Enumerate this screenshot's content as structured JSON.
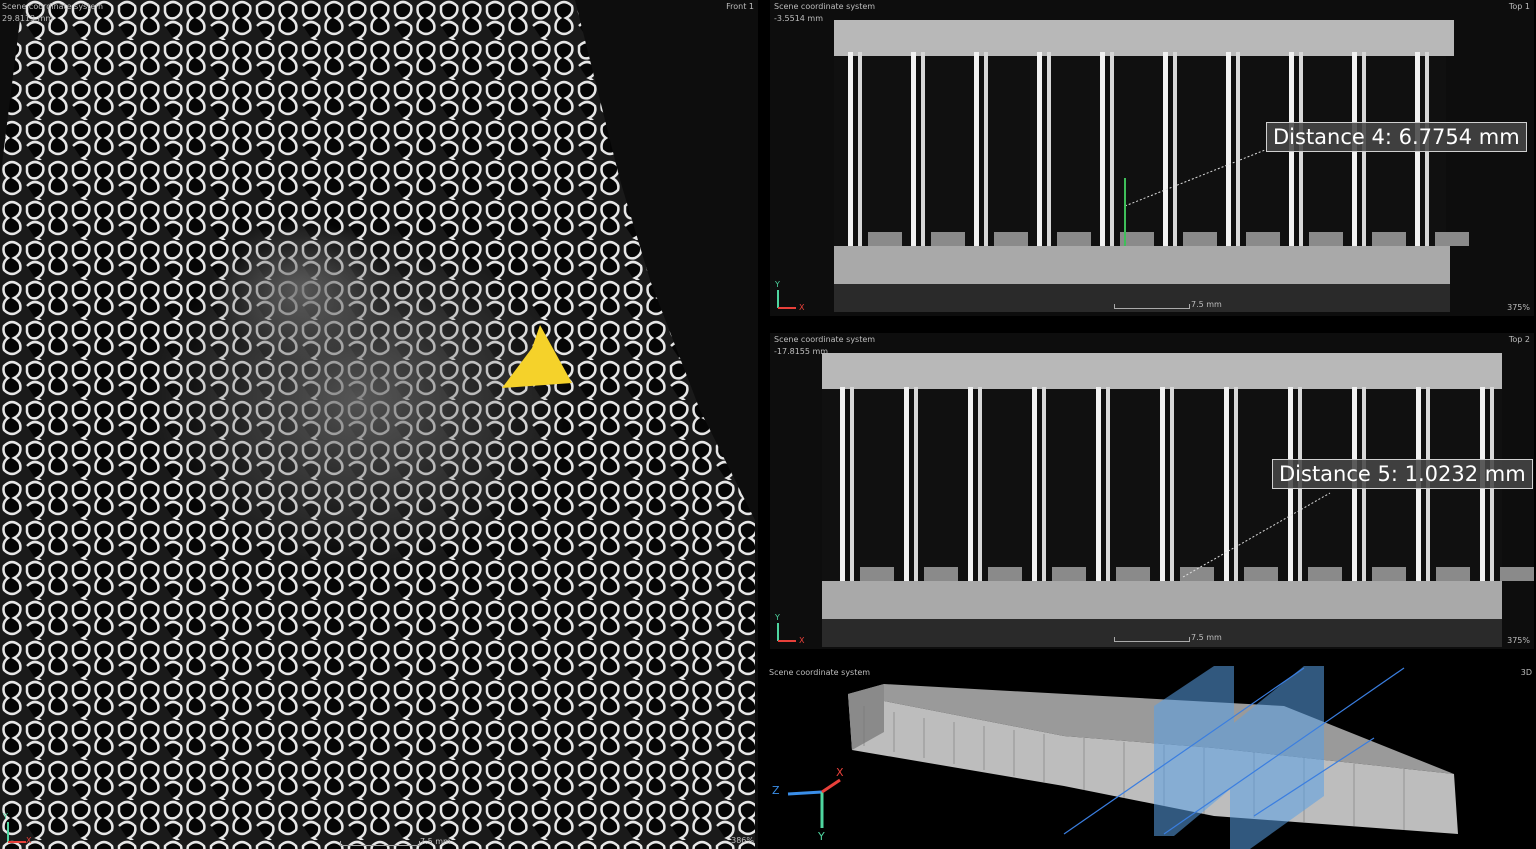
{
  "viewports": {
    "front": {
      "coord_system": "Scene coordinate system",
      "depth": "29.8113 mm",
      "name": "Front 1",
      "scale": "7.5 mm",
      "zoom": "386%"
    },
    "top1": {
      "coord_system": "Scene coordinate system",
      "depth": "-3.5514 mm",
      "name": "Top 1",
      "scale": "7.5 mm",
      "zoom": "375%",
      "measurement": "Distance 4: 6.7754 mm"
    },
    "top2": {
      "coord_system": "Scene coordinate system",
      "depth": "-17.8155 mm",
      "name": "Top 2",
      "scale": "7.5 mm",
      "zoom": "375%",
      "measurement": "Distance 5: 1.0232 mm"
    },
    "view3d": {
      "coord_system": "Scene coordinate system",
      "name": "3D"
    }
  },
  "axes": {
    "x": "X",
    "y": "Y",
    "z": "Z"
  },
  "colors": {
    "x_axis": "#e8403a",
    "y_axis": "#4fd6a0",
    "z_axis": "#3a8ee8",
    "marker": "#f5d22a",
    "clip_plane": "#5aa0e6"
  }
}
